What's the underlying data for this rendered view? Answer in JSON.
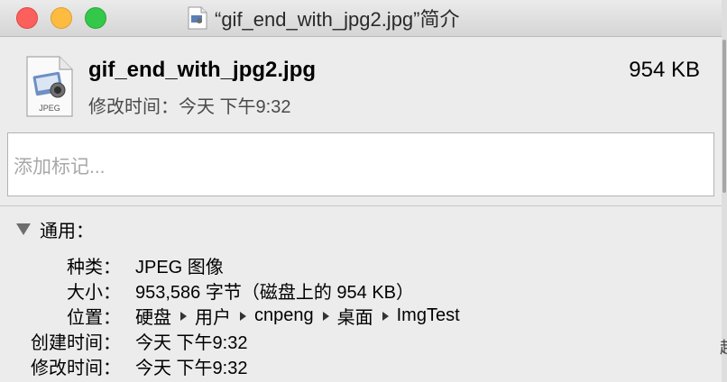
{
  "window": {
    "title": "“gif_end_with_jpg2.jpg”简介",
    "title_icon": "jpeg-document-icon",
    "traffic_lights": {
      "close": "#fc605c",
      "minimize": "#fdbc40",
      "zoom": "#34c84a"
    }
  },
  "file": {
    "name": "gif_end_with_jpg2.jpg",
    "size": "954 KB",
    "modified_summary": "修改时间：今天 下午9:32",
    "icon_label": "JPEG"
  },
  "tags": {
    "placeholder": "添加标记...",
    "value": ""
  },
  "general": {
    "title": "通用：",
    "expanded": true,
    "kind": {
      "label": "种类：",
      "value": "JPEG 图像"
    },
    "size": {
      "label": "大小：",
      "value": "953,586 字节（磁盘上的 954 KB）"
    },
    "where": {
      "label": "位置：",
      "path": [
        "硬盘",
        "用户",
        "cnpeng",
        "桌面",
        "ImgTest"
      ]
    },
    "created": {
      "label": "创建时间：",
      "value": "今天 下午9:32"
    },
    "modified": {
      "label": "修改时间：",
      "value": "今天 下午9:32"
    }
  },
  "background_partial_text": "超"
}
